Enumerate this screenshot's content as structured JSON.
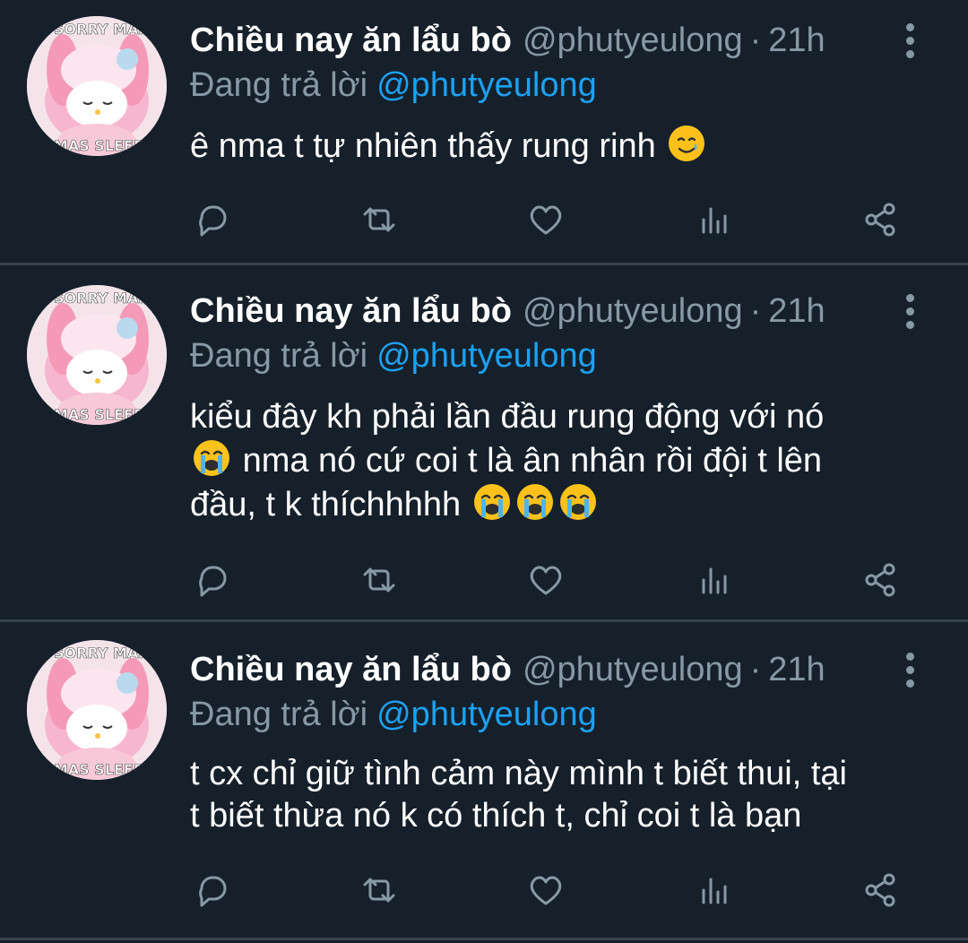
{
  "colors": {
    "background": "#15202b",
    "divider": "#38444d",
    "text": "#ffffff",
    "muted": "#8899a6",
    "accent": "#1da1f2"
  },
  "tweets": [
    {
      "name": "Chiều nay ăn lẩu bò",
      "handle": "@phutyeulong",
      "dot": "·",
      "time": "21h",
      "reply_prefix": "Đang trả lời",
      "reply_to": "@phutyeulong",
      "lines": [
        "ê nma t tự nhiên thấy rung rinh"
      ],
      "avatar_text_top": "SORRY MAN",
      "avatar_text_bottom": "MAS SLEEP"
    },
    {
      "name": "Chiều nay ăn lẩu bò",
      "handle": "@phutyeulong",
      "dot": "·",
      "time": "21h",
      "reply_prefix": "Đang trả lời",
      "reply_to": "@phutyeulong",
      "lines": [
        "kiểu đây kh phải lần đầu rung động với nó",
        "nma nó cứ coi t là ân nhân rồi đội t lên",
        "đầu, t k thíchhhhh"
      ],
      "avatar_text_top": "SORRY MAN",
      "avatar_text_bottom": "MAS SLEEP"
    },
    {
      "name": "Chiều nay ăn lẩu bò",
      "handle": "@phutyeulong",
      "dot": "·",
      "time": "21h",
      "reply_prefix": "Đang trả lời",
      "reply_to": "@phutyeulong",
      "lines": [
        "t cx chỉ giữ tình cảm này mình t biết thui, tại",
        "t biết thừa nó k có thích t, chỉ coi t là bạn"
      ],
      "avatar_text_top": "SORRY MAN",
      "avatar_text_bottom": "MAS SLEEP"
    }
  ],
  "icons": {
    "reply": "reply-icon",
    "retweet": "retweet-icon",
    "like": "heart-icon",
    "analytics": "analytics-icon",
    "share": "share-icon",
    "more": "more-vertical-icon",
    "emoji_smile_tear": "smiling-face-with-tear-icon",
    "emoji_crying": "loudly-crying-face-icon"
  }
}
